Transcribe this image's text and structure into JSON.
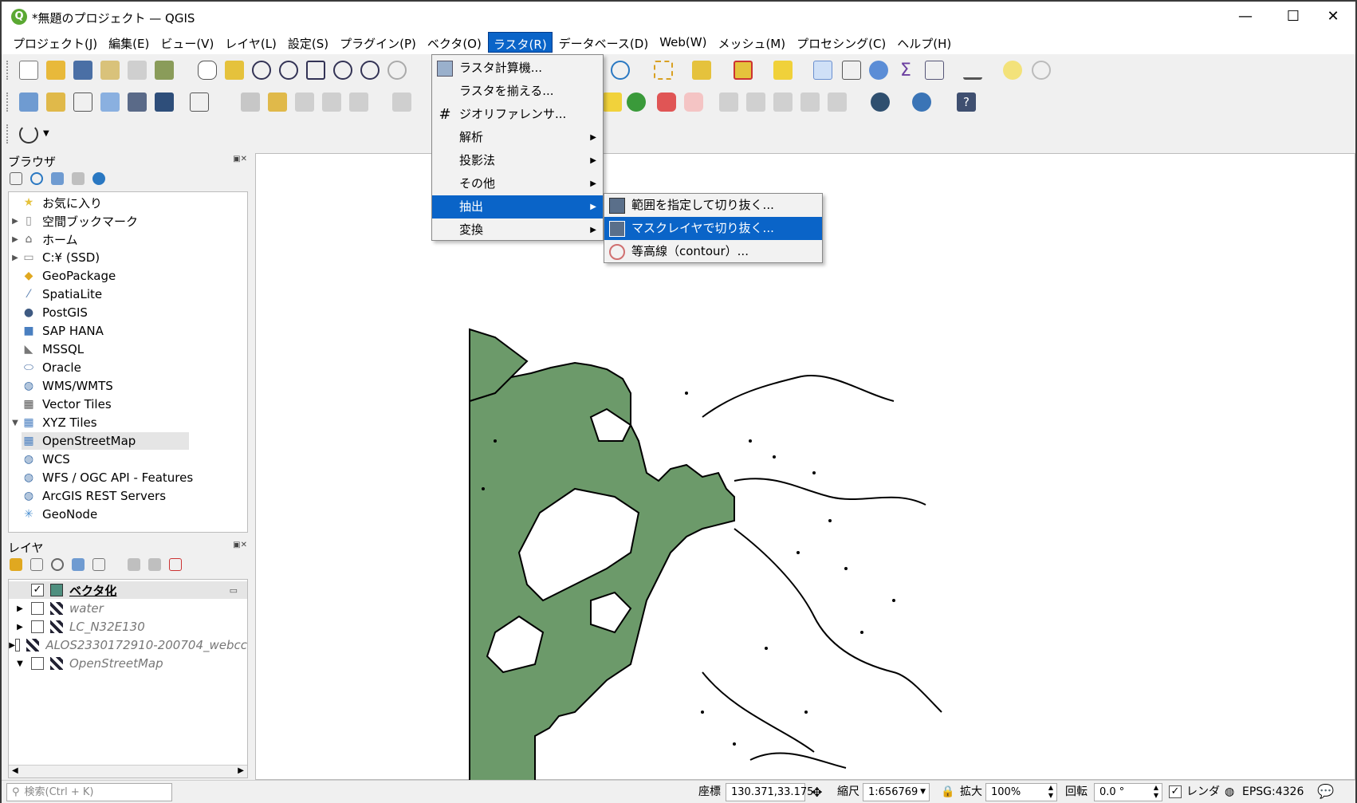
{
  "window": {
    "title": "*無題のプロジェクト — QGIS",
    "minimize": "—",
    "maximize": "☐",
    "close": "✕"
  },
  "menubar": [
    "プロジェクト(J)",
    "編集(E)",
    "ビュー(V)",
    "レイヤ(L)",
    "設定(S)",
    "プラグイン(P)",
    "ベクタ(O)",
    "ラスタ(R)",
    "データベース(D)",
    "Web(W)",
    "メッシュ(M)",
    "プロセシング(C)",
    "ヘルプ(H)"
  ],
  "raster_menu": {
    "items": [
      "ラスタ計算機...",
      "ラスタを揃える...",
      "ジオリファレンサ...",
      "解析",
      "投影法",
      "その他",
      "抽出",
      "変換"
    ],
    "submenu_arrow": "▶"
  },
  "extract_submenu": {
    "items": [
      "範囲を指定して切り抜く...",
      "マスクレイヤで切り抜く...",
      "等高線（contour）..."
    ]
  },
  "browser": {
    "title": "ブラウザ",
    "items": [
      "お気に入り",
      "空間ブックマーク",
      "ホーム",
      "C:¥ (SSD)",
      "GeoPackage",
      "SpatiaLite",
      "PostGIS",
      "SAP HANA",
      "MSSQL",
      "Oracle",
      "WMS/WMTS",
      "Vector Tiles",
      "XYZ Tiles",
      "OpenStreetMap",
      "WCS",
      "WFS / OGC API - Features",
      "ArcGIS REST Servers",
      "GeoNode"
    ]
  },
  "layers": {
    "title": "レイヤ",
    "items": [
      "ベクタ化",
      "water",
      "LC_N32E130",
      "ALOS2330172910-200704_webcc",
      "OpenStreetMap"
    ]
  },
  "status": {
    "search_placeholder": "検索(Ctrl + K)",
    "coord_label": "座標",
    "coord_value": "130.371,33.175",
    "scale_label": "縮尺",
    "scale_value": "1:656769",
    "magnify_label": "拡大",
    "magnify_value": "100%",
    "rotation_label": "回転",
    "rotation_value": "0.0 °",
    "render_label": "レンダ",
    "crs": "EPSG:4326"
  },
  "colors": {
    "accent": "#0a64c8",
    "land": "#6c9a6a"
  }
}
